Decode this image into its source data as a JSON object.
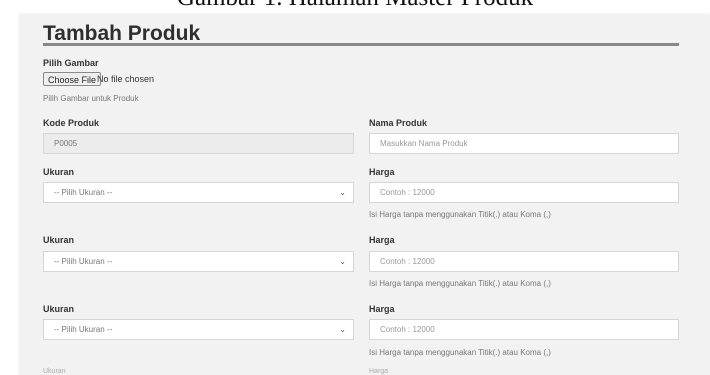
{
  "caption": "Gambar 1. Halaman Master Produk",
  "page_title": "Tambah Produk",
  "image_section": {
    "label": "Pilih Gambar",
    "button_label": "Choose File",
    "status": "No file chosen",
    "help": "Pilih Gambar untuk Produk"
  },
  "kode_produk": {
    "label": "Kode Produk",
    "value": "P0005"
  },
  "nama_produk": {
    "label": "Nama Produk",
    "placeholder": "Masukkan Nama Produk"
  },
  "rows": [
    {
      "ukuran_label": "Ukuran",
      "ukuran_value": "-- Pilih Ukuran --",
      "harga_label": "Harga",
      "harga_placeholder": "Contoh : 12000",
      "harga_help": "Isi Harga tanpa menggunakan Titik(.) atau Koma (,)"
    },
    {
      "ukuran_label": "Ukuran",
      "ukuran_value": "-- Pilih Ukuran --",
      "harga_label": "Harga",
      "harga_placeholder": "Contoh : 12000",
      "harga_help": "Isi Harga tanpa menggunakan Titik(.) atau Koma (,)"
    },
    {
      "ukuran_label": "Ukuran",
      "ukuran_value": "-- Pilih Ukuran --",
      "harga_label": "Harga",
      "harga_placeholder": "Contoh : 12000",
      "harga_help": "Isi Harga tanpa menggunakan Titik(.) atau Koma (,)"
    }
  ],
  "next_row_partial": {
    "ukuran_label": "Ukuran",
    "harga_label": "Harga"
  }
}
